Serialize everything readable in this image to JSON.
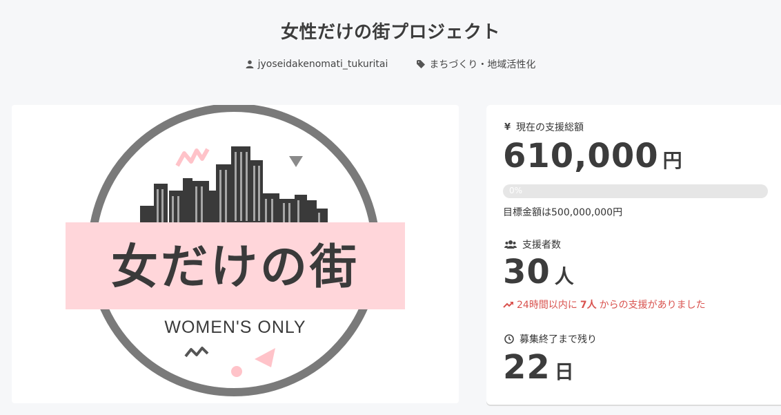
{
  "page": {
    "title": "女性だけの街プロジェクト"
  },
  "meta": {
    "author": "jyoseidakenomati_tukuritai",
    "category": "まちづくり・地域活性化",
    "author_icon": "user-icon",
    "category_icon": "tag-icon"
  },
  "hero": {
    "banner_text": "女だけの街",
    "subtitle": "WOMEN'S ONLY",
    "colors": {
      "ring": "#7a7a7a",
      "banner": "#ffd6da",
      "accent_pink": "#ffb8c0",
      "text": "#3a3a3a"
    }
  },
  "stats": {
    "funding": {
      "label": "現在の支援総額",
      "icon": "yen-icon",
      "amount": "610,000",
      "unit": "円",
      "progress_percent": 0,
      "progress_label": "0%",
      "goal_text": "目標金額は500,000,000円"
    },
    "supporters": {
      "label": "支援者数",
      "icon": "users-icon",
      "count": "30",
      "unit": "人",
      "trend_prefix": "24時間以内に",
      "trend_count": "7人",
      "trend_suffix": "からの支援がありました",
      "trend_color": "#d9534f"
    },
    "remaining": {
      "label": "募集終了まで残り",
      "icon": "clock-icon",
      "days": "22",
      "unit": "日"
    }
  }
}
